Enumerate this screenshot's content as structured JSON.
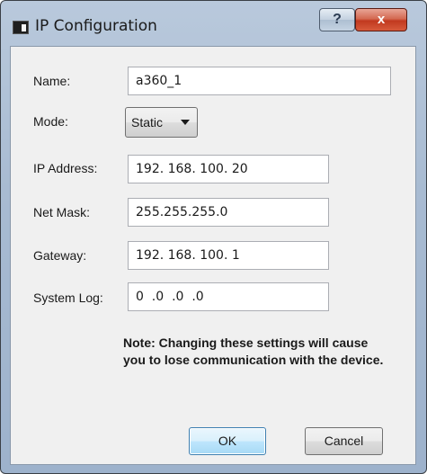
{
  "window": {
    "title": "IP Configuration",
    "help_label": "?",
    "close_label": "x"
  },
  "form": {
    "name": {
      "label": "Name:",
      "value": "a360_1"
    },
    "mode": {
      "label": "Mode:",
      "value": "Static"
    },
    "ip_address": {
      "label": "IP Address:",
      "value": "192. 168. 100. 20"
    },
    "net_mask": {
      "label": "Net Mask:",
      "value": "255.255.255.0"
    },
    "gateway": {
      "label": "Gateway:",
      "value": "192. 168. 100. 1"
    },
    "system_log": {
      "label": "System Log:",
      "value": "0  .0  .0  .0"
    }
  },
  "note": "Note: Changing these settings will cause you to lose communication with the device.",
  "buttons": {
    "ok": "OK",
    "cancel": "Cancel"
  }
}
